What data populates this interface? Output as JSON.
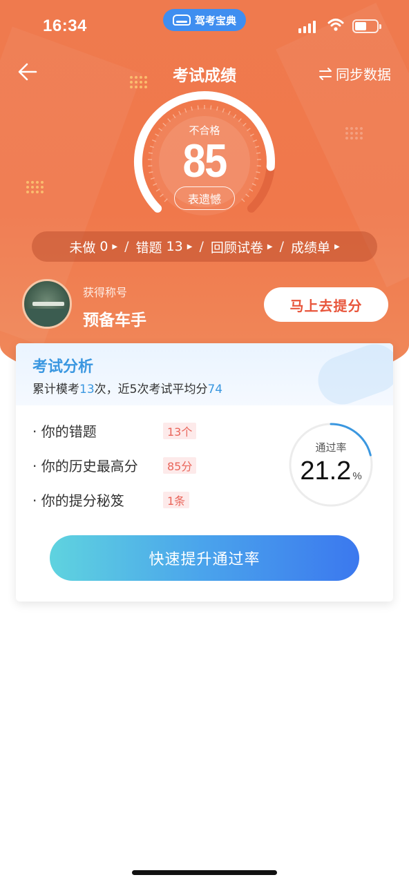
{
  "status_bar": {
    "time": "16:34",
    "app_pill": "驾考宝典"
  },
  "nav": {
    "title": "考试成绩",
    "sync_label": "同步数据"
  },
  "gauge": {
    "status": "不合格",
    "score": "85",
    "tag": "表遗憾",
    "score_fraction": 0.85
  },
  "shortcuts": [
    {
      "label": "未做",
      "count": "0"
    },
    {
      "label": "错题",
      "count": "13"
    },
    {
      "label": "回顾试卷",
      "count": ""
    },
    {
      "label": "成绩单",
      "count": ""
    }
  ],
  "title_row": {
    "label": "获得称号",
    "name": "预备车手",
    "button": "马上去提分"
  },
  "analysis": {
    "title": "考试分析",
    "sub_prefix": "累计模考",
    "mock_count": "13",
    "sub_middle": "次，近5次考试平均分",
    "avg_score": "74",
    "stats": [
      {
        "label": "· 你的错题",
        "value": "13个"
      },
      {
        "label": "· 你的历史最高分",
        "value": "85分"
      },
      {
        "label": "· 你的提分秘笈",
        "value": "1条"
      }
    ],
    "pass_rate_label": "通过率",
    "pass_rate_value": "21.2",
    "pass_rate_unit": "%",
    "pass_rate_fraction": 0.212,
    "cta": "快速提升通过率"
  },
  "colors": {
    "hero": "#f0784b",
    "accent_blue": "#3a97e0",
    "warn_red": "#e9655a"
  }
}
